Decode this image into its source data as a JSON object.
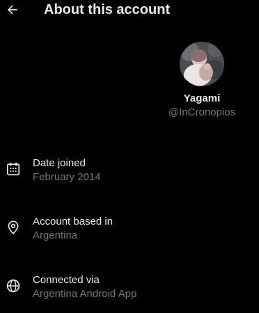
{
  "header": {
    "title": "About this account",
    "back_icon": "arrow-left-icon"
  },
  "profile": {
    "display_name": "Yagami",
    "username": "@InCronopios"
  },
  "details": {
    "date_joined": {
      "label": "Date joined",
      "value": "February 2014",
      "icon": "calendar-icon"
    },
    "account_based_in": {
      "label": "Account based in",
      "value": "Argentina",
      "icon": "location-pin-icon"
    },
    "connected_via": {
      "label": "Connected via",
      "value": "Argentina Android App",
      "icon": "globe-icon"
    }
  },
  "colors": {
    "background": "#000000",
    "primary_text": "#e7e9ea",
    "secondary_text": "#71767b"
  }
}
